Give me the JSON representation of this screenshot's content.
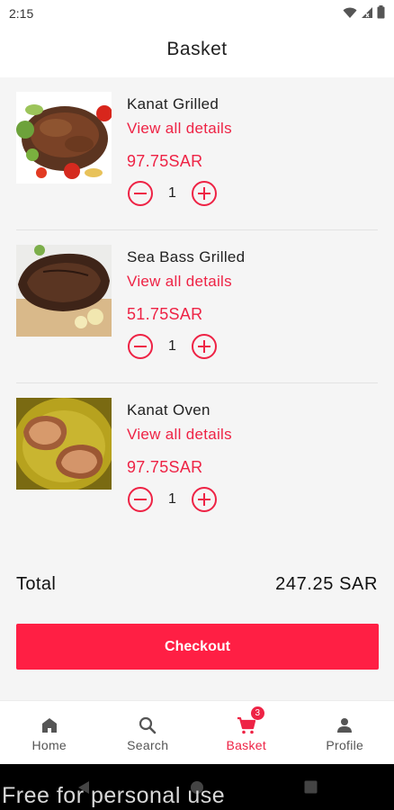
{
  "status_bar": {
    "time": "2:15"
  },
  "header": {
    "title": "Basket"
  },
  "items": [
    {
      "name": "Kanat Grilled",
      "details_label": "View all details",
      "price": "97.75SAR",
      "quantity": "1",
      "image": "grilled-fish-with-tomatoes"
    },
    {
      "name": "Sea Bass Grilled",
      "details_label": "View all details",
      "price": "51.75SAR",
      "quantity": "1",
      "image": "grilled-sea-bass-on-board"
    },
    {
      "name": "Kanat Oven",
      "details_label": "View all details",
      "price": "97.75SAR",
      "quantity": "1",
      "image": "oven-fish-steaks-on-plate"
    }
  ],
  "summary": {
    "total_label": "Total",
    "total_value": "247.25 SAR"
  },
  "checkout_label": "Checkout",
  "nav": {
    "items": [
      {
        "label": "Home",
        "icon": "home-icon"
      },
      {
        "label": "Search",
        "icon": "search-icon"
      },
      {
        "label": "Basket",
        "icon": "cart-icon",
        "badge": "3",
        "active": true
      },
      {
        "label": "Profile",
        "icon": "person-icon"
      }
    ]
  },
  "watermark": "Free for personal use",
  "colors": {
    "accent": "#ee2345",
    "checkout_bg": "#ff1f44",
    "background": "#f5f5f5"
  }
}
